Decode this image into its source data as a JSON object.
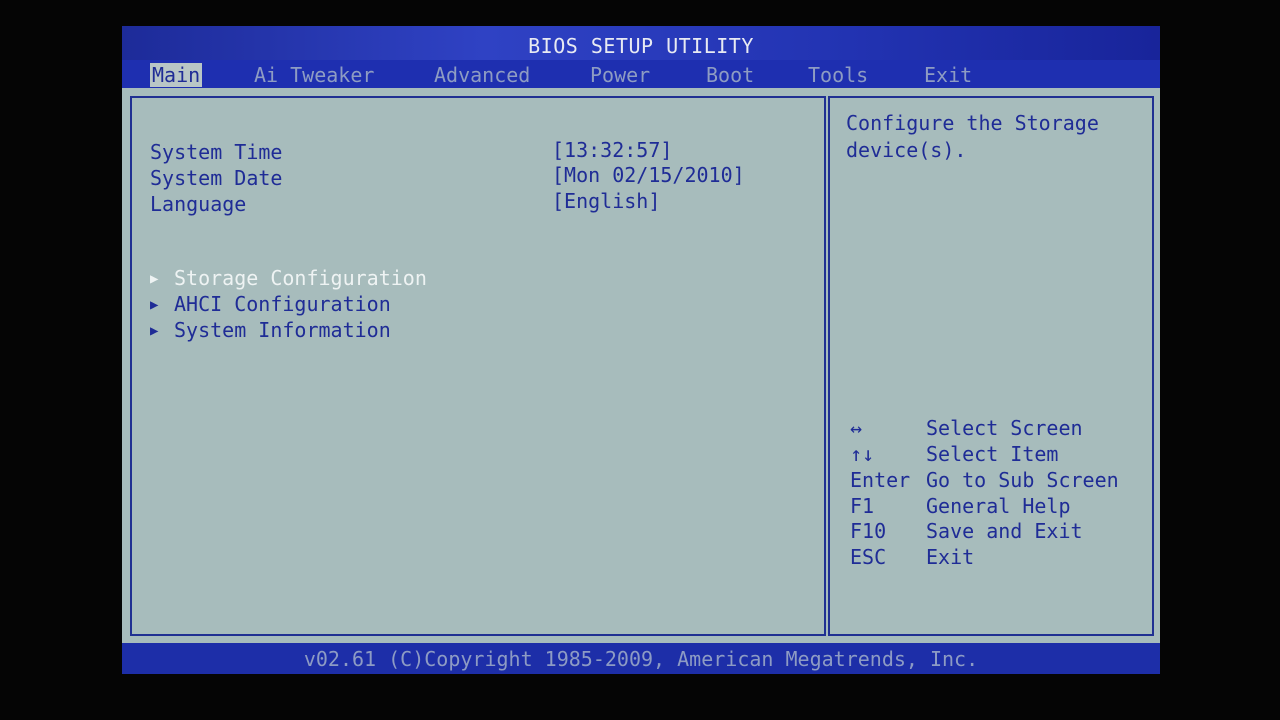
{
  "title": "BIOS SETUP UTILITY",
  "menu_tabs": [
    {
      "label": "Main",
      "active": true
    },
    {
      "label": "Ai Tweaker"
    },
    {
      "label": "Advanced"
    },
    {
      "label": "Power"
    },
    {
      "label": "Boot"
    },
    {
      "label": "Tools"
    },
    {
      "label": "Exit"
    }
  ],
  "settings": [
    {
      "label": "System Time",
      "value": "[13:32:57]"
    },
    {
      "label": "System Date",
      "value": "[Mon 02/15/2010]"
    },
    {
      "label": "Language",
      "value": "[English]"
    }
  ],
  "submenus": [
    {
      "label": "Storage Configuration",
      "selected": true
    },
    {
      "label": "AHCI Configuration"
    },
    {
      "label": "System Information"
    }
  ],
  "submenu_arrow_icon": "triangle-right-icon",
  "help": {
    "description": "Configure the Storage device(s).",
    "keys": [
      {
        "key": "↔",
        "action": "Select Screen"
      },
      {
        "key": "↑↓",
        "action": "Select Item"
      },
      {
        "key": "Enter",
        "action": "Go to Sub Screen"
      },
      {
        "key": "F1",
        "action": "General Help"
      },
      {
        "key": "F10",
        "action": "Save and Exit"
      },
      {
        "key": "ESC",
        "action": "Exit"
      }
    ]
  },
  "footer": "v02.61 (C)Copyright 1985-2009, American Megatrends, Inc.",
  "colors": {
    "background": "#a7bcbc",
    "text": "#1f2c96",
    "bar": "#1e2fb0",
    "highlight_text": "#eef3f3"
  }
}
